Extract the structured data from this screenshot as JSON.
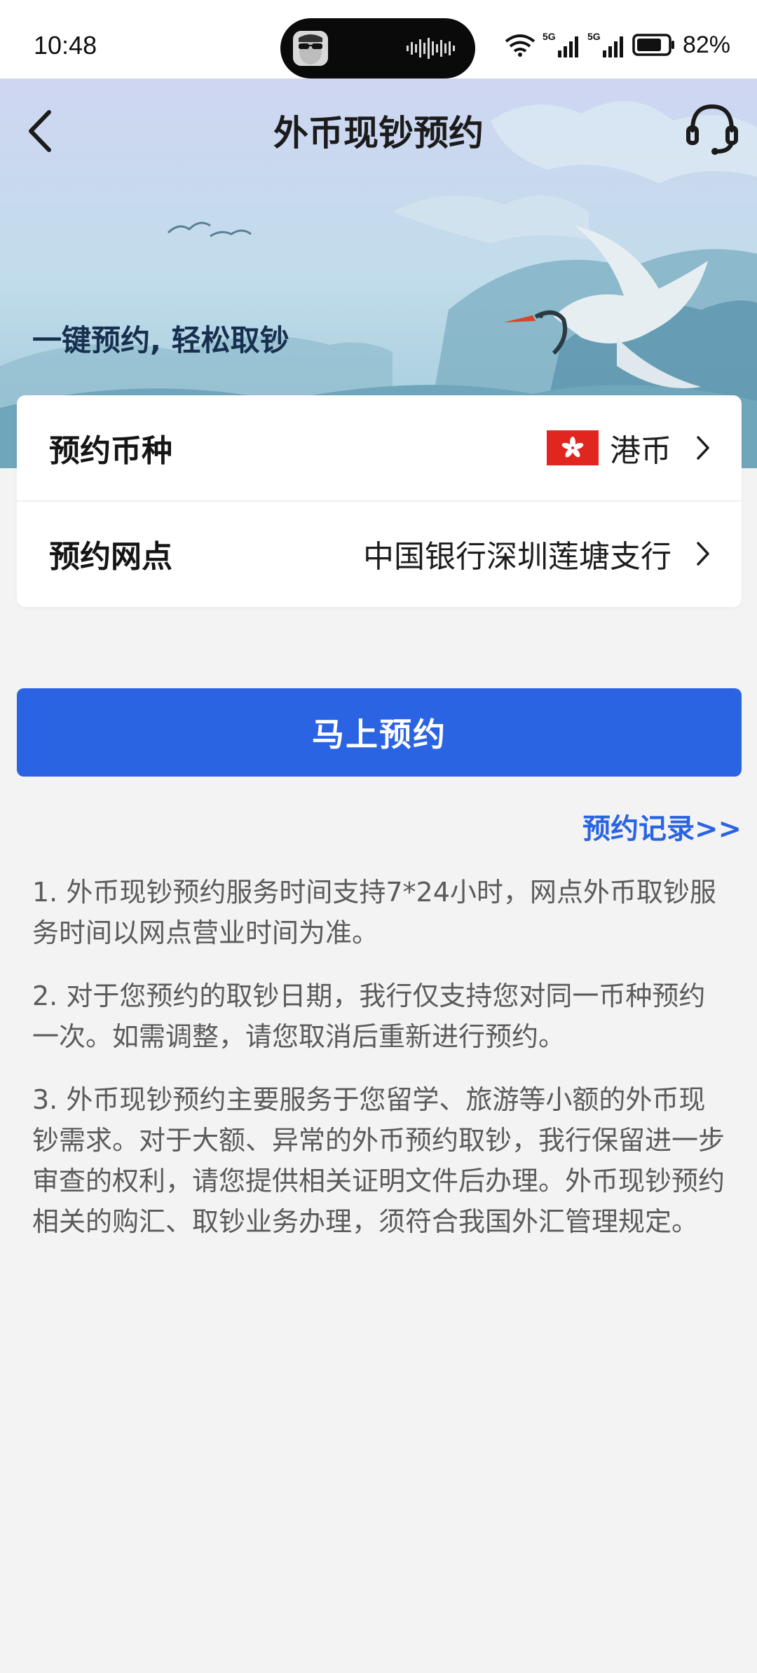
{
  "status_bar": {
    "time": "10:48",
    "network_1": "5G",
    "network_2": "5G",
    "battery_percent": "82%",
    "battery_level": 0.82
  },
  "header": {
    "title": "外币现钞预约",
    "slogan": "一键预约, 轻松取钞"
  },
  "form": {
    "currency": {
      "label": "预约币种",
      "value": "港币",
      "flag_icon": "hong-kong-flag-icon"
    },
    "branch": {
      "label": "预约网点",
      "value": "中国银行深圳莲塘支行"
    }
  },
  "actions": {
    "submit_label": "马上预约",
    "records_link": "预约记录>>"
  },
  "notes": [
    "1. 外币现钞预约服务时间支持7*24小时，网点外币取钞服务时间以网点营业时间为准。",
    "2. 对于您预约的取钞日期，我行仅支持您对同一币种预约一次。如需调整，请您取消后重新进行预约。",
    "3. 外币现钞预约主要服务于您留学、旅游等小额的外币现钞需求。对于大额、异常的外币预约取钞，我行保留进一步审查的权利，请您提供相关证明文件后办理。外币现钞预约相关的购汇、取钞业务办理，须符合我国外汇管理规定。"
  ],
  "colors": {
    "primary": "#2a64e3",
    "page_bg": "#f3f3f4",
    "flag_red": "#e0261f"
  }
}
